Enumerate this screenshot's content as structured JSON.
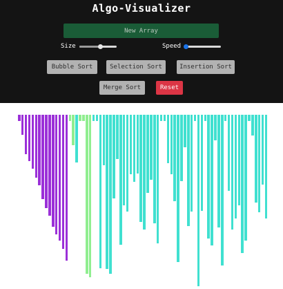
{
  "header": {
    "title": "Algo-Visualizer"
  },
  "controls": {
    "new_array_label": "New Array",
    "size_label": "Size",
    "size_value_fraction": 0.55,
    "speed_label": "Speed",
    "speed_value_fraction": 0.0,
    "buttons": {
      "bubble": "Bubble Sort",
      "selection": "Selection Sort",
      "insertion": "Insertion Sort",
      "merge": "Merge Sort",
      "reset": "Reset"
    }
  },
  "colors": {
    "panel_background": "#141414",
    "new_array_button": "#1a5c37",
    "sorted_bar": "#9b30d8",
    "active_bar": "#90ee90",
    "unsorted_bar": "#40e0d0",
    "reset_button": "#dc3545",
    "speed_accent": "#1a73e8"
  },
  "array": {
    "values": [
      9,
      29,
      57,
      66,
      77,
      90,
      101,
      121,
      134,
      145,
      161,
      172,
      181,
      193,
      209,
      9,
      44,
      68,
      9,
      9,
      228,
      233,
      9,
      9,
      220,
      72,
      221,
      228,
      120,
      64,
      187,
      130,
      139,
      85,
      96,
      84,
      154,
      165,
      112,
      93,
      156,
      185,
      9,
      9,
      69,
      85,
      124,
      211,
      95,
      47,
      160,
      139,
      9,
      246,
      138,
      9,
      178,
      188,
      37,
      162,
      216,
      9,
      109,
      165,
      149,
      130,
      198,
      181,
      9,
      30,
      126,
      140,
      100,
      149
    ],
    "sorted_count": 15,
    "active_indices": [
      15,
      16,
      18,
      19,
      20,
      21
    ],
    "max_value": 260
  }
}
